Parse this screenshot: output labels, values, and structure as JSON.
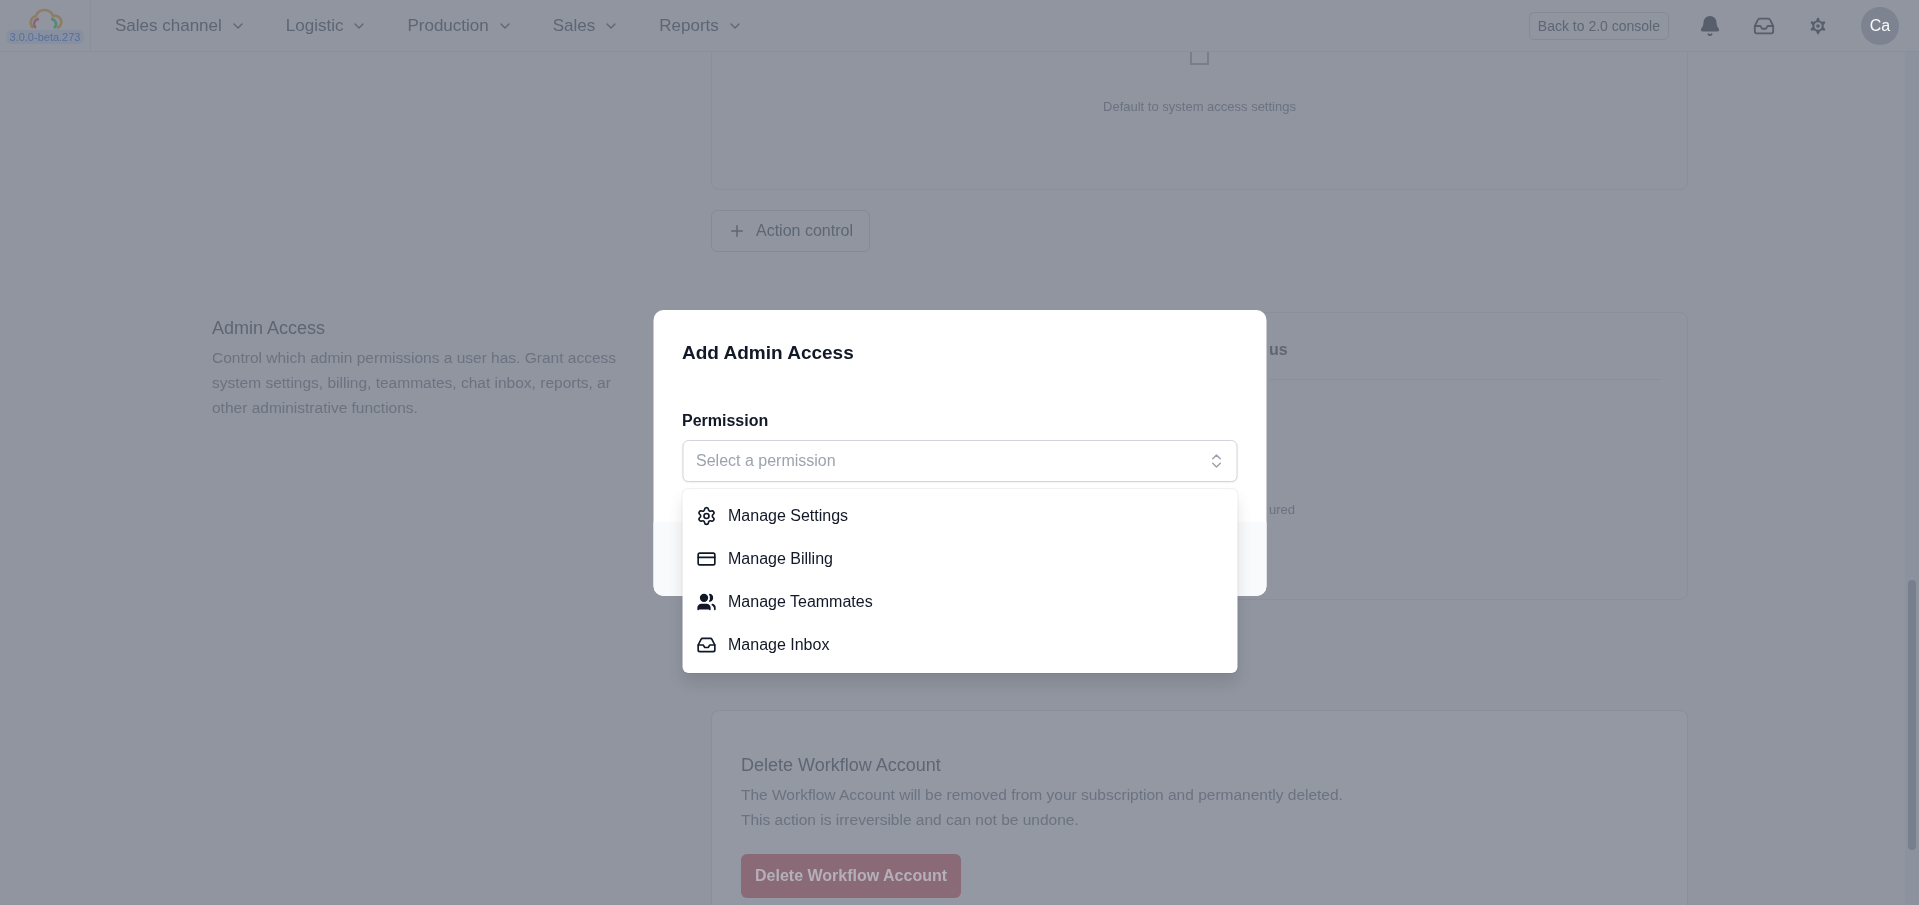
{
  "header": {
    "version": "3.0.0-beta.273",
    "nav": [
      "Sales channel",
      "Logistic",
      "Production",
      "Sales",
      "Reports"
    ],
    "console_button": "Back to 2.0 console",
    "avatar": "Ca"
  },
  "access_card": {
    "note": "Default to system access settings",
    "add_button": "Action control"
  },
  "admin_access": {
    "title": "Admin Access",
    "description_lines": [
      "Control which admin permissions a user has. Grant access",
      "system settings, billing, teammates, chat inbox, reports, ar",
      "other administrative functions."
    ]
  },
  "status_card": {
    "heading_fragment": "us",
    "note_fragment": "ured"
  },
  "delete_section": {
    "title": "Delete Workflow Account",
    "description_lines": [
      "The Workflow Account will be removed from your subscription and permanently deleted.",
      "This action is irreversible and can not be undone."
    ],
    "button": "Delete Workflow Account"
  },
  "dialog": {
    "title": "Add Admin Access",
    "field_label": "Permission",
    "placeholder": "Select a permission",
    "options": [
      "Manage Settings",
      "Manage Billing",
      "Manage Teammates",
      "Manage Inbox"
    ]
  }
}
